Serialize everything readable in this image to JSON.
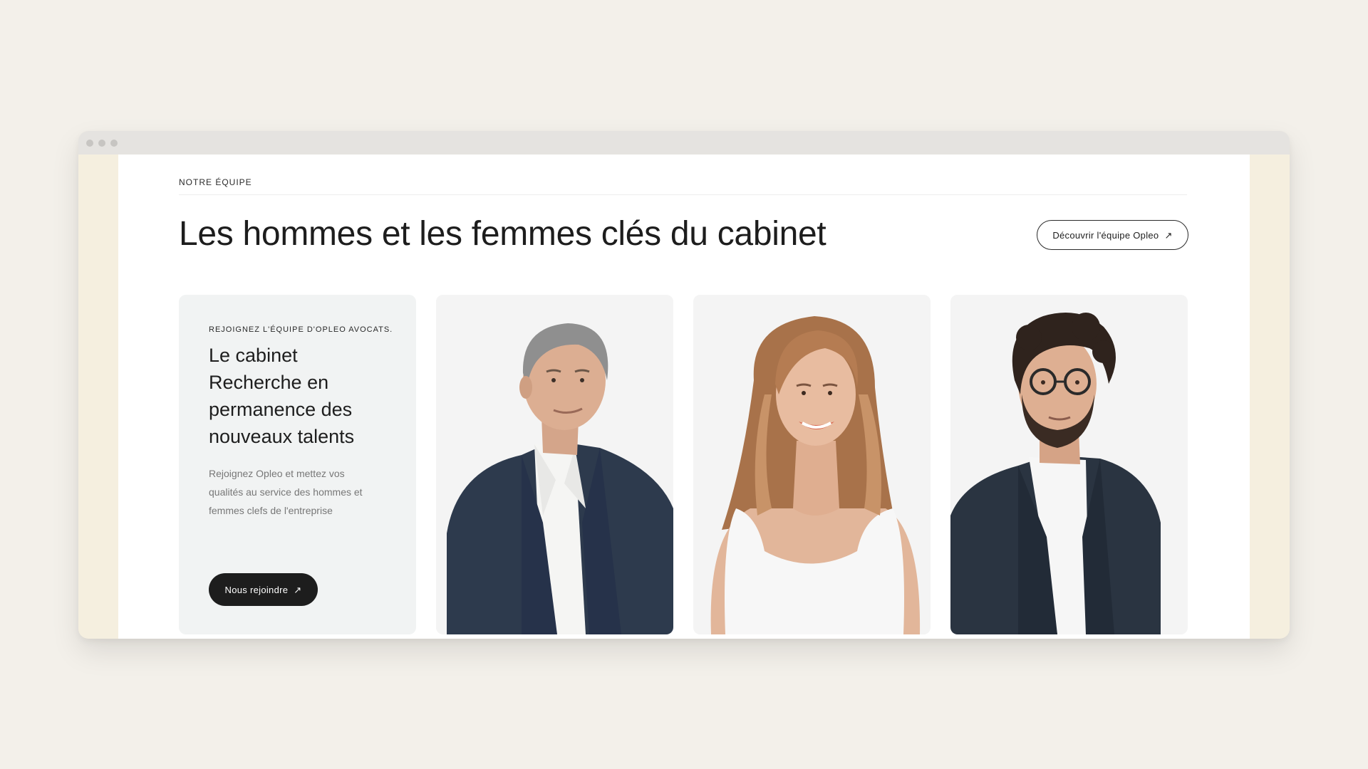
{
  "section": {
    "eyebrow": "NOTRE ÉQUIPE",
    "title": "Les hommes et les femmes clés du cabinet",
    "team_button_label": "Découvrir l'équipe Opleo"
  },
  "join_card": {
    "eyebrow": "REJOIGNEZ L'ÉQUIPE D'OPLEO AVOCATS.",
    "title": "Le cabinet Recherche en permanence des nouveaux talents",
    "description": "Rejoignez Opleo et mettez vos qualités au service des hommes et femmes clefs de l'entreprise",
    "button_label": "Nous rejoindre"
  },
  "icons": {
    "external_arrow": "arrow-up-right-icon"
  },
  "colors": {
    "page_background": "#f3f0ea",
    "browser_frame": "#f5efdf",
    "dark_button": "#1d1d1d",
    "join_card_background": "#f1f3f3",
    "photo_card_background": "#f4f4f4"
  }
}
